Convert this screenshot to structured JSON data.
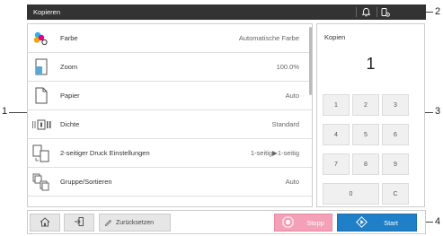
{
  "titlebar": {
    "title": "Kopieren",
    "icons": [
      "bell-icon",
      "gear-phone-icon"
    ]
  },
  "settings": [
    {
      "label": "Farbe",
      "value": "Automatische Farbe",
      "icon": "color-dots-icon"
    },
    {
      "label": "Zoom",
      "value": "100.0%",
      "icon": "zoom-page-icon"
    },
    {
      "label": "Papier",
      "value": "Auto",
      "icon": "paper-icon"
    },
    {
      "label": "Dichte",
      "value": "Standard",
      "icon": "density-icon"
    },
    {
      "label": "2-seitiger Druck Einstellungen",
      "value": "1-seitig▶1-seitig",
      "icon": "duplex-icon"
    },
    {
      "label": "Gruppe/Sortieren",
      "value": "Auto",
      "icon": "sort-icon"
    }
  ],
  "copies": {
    "label": "Kopien",
    "value": "1"
  },
  "keypad": [
    "1",
    "2",
    "3",
    "4",
    "5",
    "6",
    "7",
    "8",
    "9",
    "0",
    "C"
  ],
  "bottombar": {
    "reset_label": "Zurücksetzen",
    "stop_label": "Stopp",
    "start_label": "Start"
  },
  "callouts": [
    "1",
    "2",
    "3",
    "4"
  ],
  "colors": {
    "titlebar_bg": "#333333",
    "stop_bg": "#f4a0b6",
    "start_bg": "#1f7fc7"
  }
}
